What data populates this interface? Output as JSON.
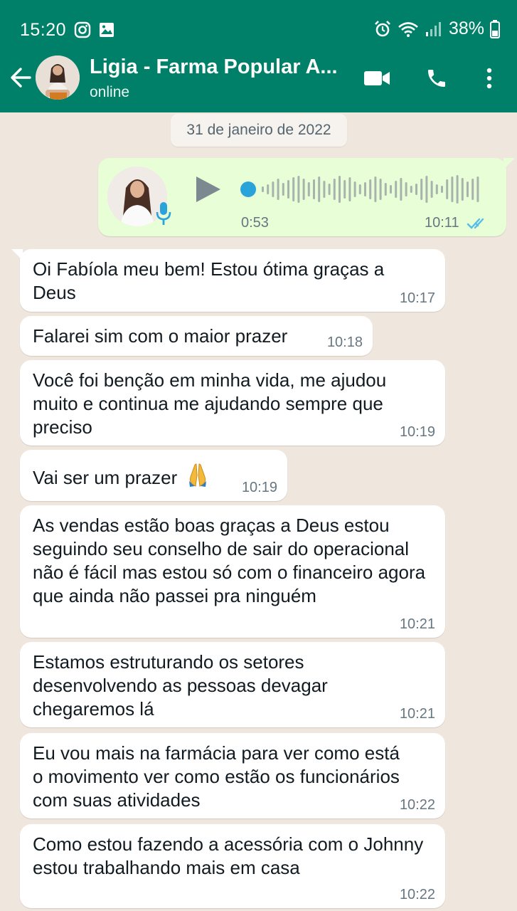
{
  "status_bar": {
    "time": "15:20",
    "battery": "38%"
  },
  "header": {
    "contact_name": "Ligia - Farma Popular A...",
    "contact_status": "online"
  },
  "date_chip": "31 de janeiro de 2022",
  "voice_message": {
    "duration": "0:53",
    "time": "10:11"
  },
  "messages": [
    {
      "text": "Oi Fabíola meu bem! Estou ótima graças a Deus",
      "time": "10:17"
    },
    {
      "text": "Falarei sim com o maior prazer",
      "time": "10:18"
    },
    {
      "text": "Você foi benção em minha vida, me ajudou muito e continua me ajudando sempre que preciso",
      "time": "10:19"
    },
    {
      "text": "Vai ser um prazer",
      "time": "10:19"
    },
    {
      "text": "As vendas estão boas graças a Deus estou seguindo seu conselho de sair do operacional não é fácil mas estou só com o financeiro agora que ainda não passei pra ninguém",
      "time": "10:21"
    },
    {
      "text": "Estamos estruturando os setores desenvolvendo as pessoas devagar chegaremos lá",
      "time": "10:21"
    },
    {
      "text": "Eu vou mais na farmácia para ver como está o movimento ver como estão os funcionários com suas atividades",
      "time": "10:22"
    },
    {
      "text": "Como estou fazendo a acessória com o Johnny estou trabalhando mais em casa",
      "time": "10:22"
    }
  ],
  "colors": {
    "header": "#008069",
    "outgoing_bubble": "#e7fed6",
    "incoming_bubble": "#ffffff",
    "wallpaper": "#efe7de",
    "read_ticks": "#53bdeb"
  }
}
